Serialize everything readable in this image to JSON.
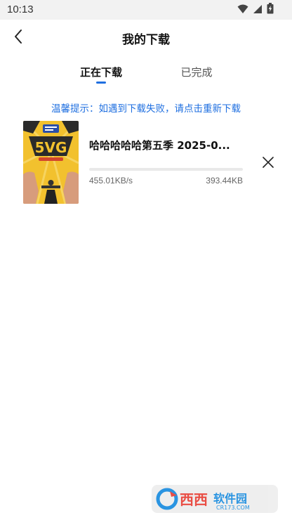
{
  "status_bar": {
    "time": "10:13",
    "icons": [
      "wifi-icon",
      "signal-icon",
      "battery-charging-icon"
    ]
  },
  "header": {
    "title": "我的下载",
    "back_icon": "chevron-left-icon"
  },
  "tabs": [
    {
      "label": "正在下载",
      "active": true
    },
    {
      "label": "已完成",
      "active": false
    }
  ],
  "tip": "温馨提示：如遇到下载失败，请点击重新下载",
  "downloads": [
    {
      "title": "哈哈哈哈哈第五季 2025-0...",
      "speed": "455.01KB/s",
      "size": "393.44KB",
      "progress": 0,
      "poster_text": "5VG"
    }
  ],
  "colors": {
    "accent": "#1f6fe0",
    "poster_yellow": "#f2c12e"
  }
}
